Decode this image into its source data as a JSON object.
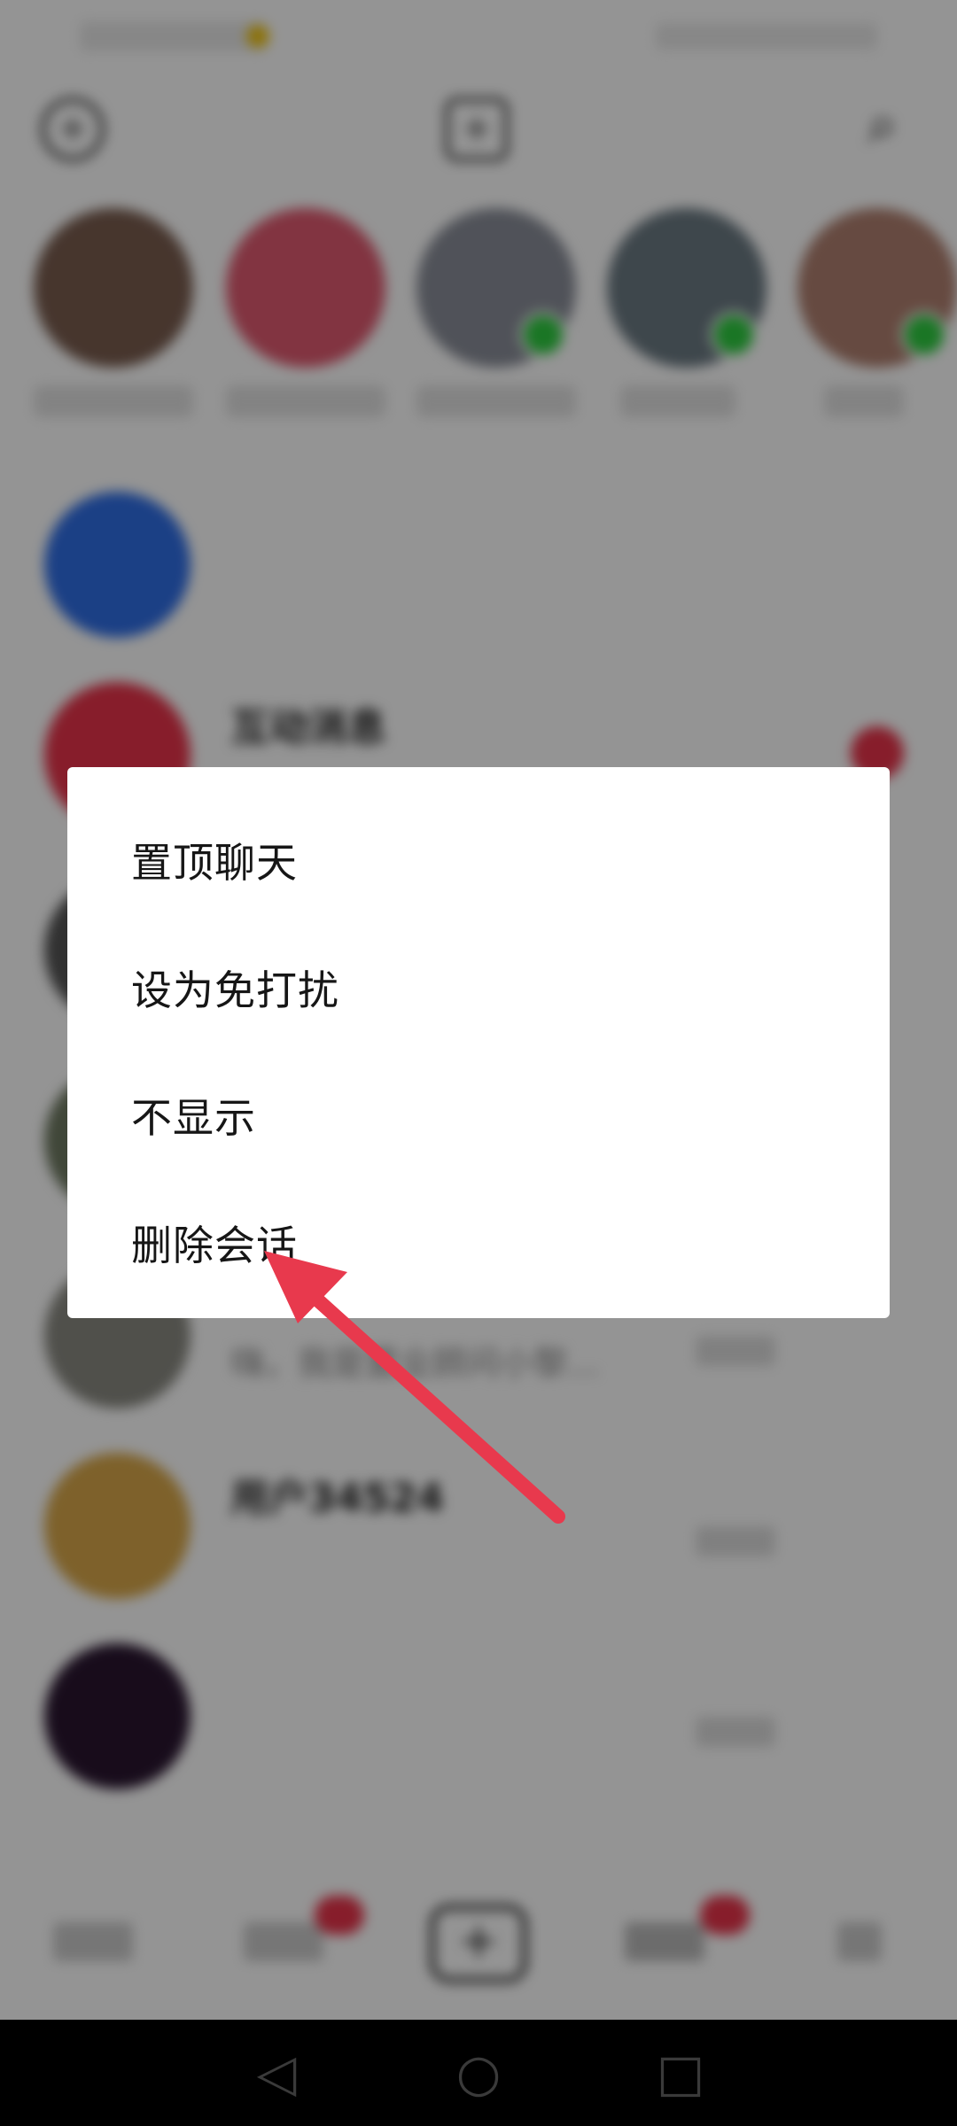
{
  "colors": {
    "accent_red": "#e8334a",
    "arrow_red": "#e8394d",
    "new_friend_blue": "#2f6ee6",
    "online_green": "#2ecc40"
  },
  "topbar": {
    "icons": [
      "add-contact-icon",
      "add-post-icon",
      "search-icon"
    ]
  },
  "conversations": [
    {
      "title": "",
      "sub": ""
    },
    {
      "title": "互动消息",
      "sub": ""
    },
    {
      "title": "",
      "sub": ""
    },
    {
      "title": "",
      "sub": ""
    },
    {
      "title": "",
      "sub": "嗨，我是置业顾问小黎..."
    },
    {
      "title": "用户34524",
      "sub": ""
    },
    {
      "title": "",
      "sub": ""
    }
  ],
  "context_menu": {
    "items": [
      {
        "label": "置顶聊天"
      },
      {
        "label": "设为免打扰"
      },
      {
        "label": "不显示"
      },
      {
        "label": "删除会话"
      }
    ]
  },
  "annotation": {
    "type": "arrow",
    "points_to": "删除会话"
  },
  "system_nav": {
    "icons": [
      "back-icon",
      "home-icon",
      "recents-icon"
    ]
  }
}
